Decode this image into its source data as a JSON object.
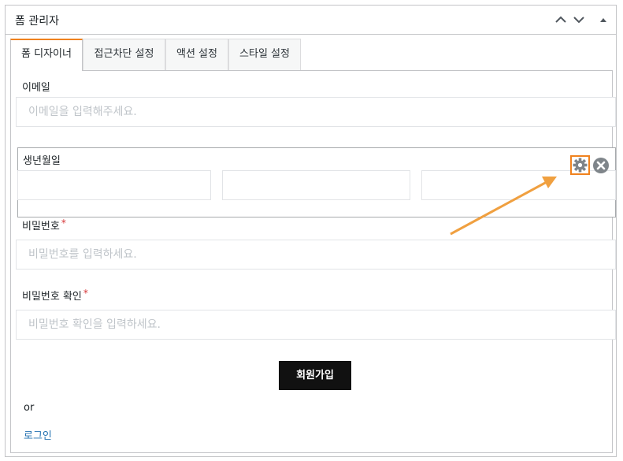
{
  "panel": {
    "title": "폼 관리자",
    "up_icon": "chevron-up-icon",
    "down_icon": "chevron-down-icon",
    "toggle_icon": "triangle-up-icon"
  },
  "tabs": [
    {
      "label": "폼 디자이너",
      "active": true
    },
    {
      "label": "접근차단 설정",
      "active": false
    },
    {
      "label": "액션 설정",
      "active": false
    },
    {
      "label": "스타일 설정",
      "active": false
    }
  ],
  "form": {
    "email": {
      "label": "이메일",
      "placeholder": "이메일을 입력해주세요."
    },
    "birthdate": {
      "label": "생년월일",
      "settings_icon": "gear-icon",
      "delete_icon": "close-circle-icon"
    },
    "password": {
      "label": "비밀번호",
      "required_mark": "*",
      "placeholder": "비밀번호를 입력하세요."
    },
    "password_confirm": {
      "label": "비밀번호 확인",
      "required_mark": "*",
      "placeholder": "비밀번호 확인을 입력하세요."
    },
    "submit_label": "회원가입",
    "or_text": "or",
    "login_link": "로그인"
  },
  "colors": {
    "accent_orange": "#f0821e",
    "link_blue": "#2271b1",
    "required_red": "#d63638",
    "submit_bg": "#111111"
  },
  "annotation": {
    "arrow_icon": "arrow-icon"
  }
}
